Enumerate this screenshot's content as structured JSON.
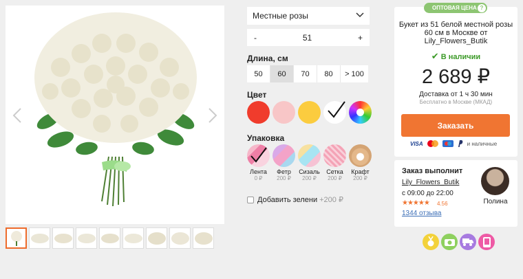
{
  "gallery": {
    "thumb_count": 9,
    "active_thumb": 0
  },
  "options": {
    "variety": "Местные розы",
    "quantity": {
      "minus": "-",
      "value": "51",
      "plus": "+"
    },
    "length": {
      "label": "Длина, см",
      "items": [
        "50",
        "60",
        "70",
        "80",
        "> 100"
      ],
      "selected": "60"
    },
    "color": {
      "label": "Цвет",
      "items": [
        {
          "name": "red",
          "hex": "#f03c2c"
        },
        {
          "name": "pink",
          "hex": "#f8c6c7"
        },
        {
          "name": "yellow",
          "hex": "#fbcc3f"
        },
        {
          "name": "white",
          "hex": "#ffffff"
        },
        {
          "name": "multicolor",
          "hex": "rainbow"
        }
      ],
      "selected": "white"
    },
    "packaging": {
      "label": "Упаковка",
      "items": [
        {
          "name": "Лента",
          "price": "0 ₽"
        },
        {
          "name": "Фетр",
          "price": "200 ₽"
        },
        {
          "name": "Сизаль",
          "price": "200 ₽"
        },
        {
          "name": "Сетка",
          "price": "200 ₽"
        },
        {
          "name": "Крафт",
          "price": "200 ₽"
        }
      ],
      "selected": "Лента"
    },
    "greens": {
      "label": "Добавить зелени",
      "price": "+200 ₽"
    }
  },
  "product": {
    "badge": "ОПТОВАЯ ЦЕНА",
    "badge_help": "?",
    "title": "Букет из 51 белой местной розы 60 см в Москве от Lily_Flowers_Butik",
    "stock": "В наличии",
    "price": "2 689 ₽",
    "delivery": "Доставка от 1 ч 30 мин",
    "delivery_note": "Бесплатно в Москве (МКАД)",
    "order_button": "Заказать",
    "payment": {
      "visa": "VISA",
      "cash": "и наличные"
    }
  },
  "seller": {
    "heading": "Заказ выполнит",
    "name": "Lily_Flowers_Butik",
    "hours": "с 09:00 до 22:00",
    "stars": 5,
    "rating": "4.56",
    "reviews": "1344 отзыва",
    "avatar_name": "Полина"
  },
  "achievements": [
    {
      "icon": "medal-icon",
      "color": "#f3d23a"
    },
    {
      "icon": "camera-icon",
      "color": "#8ed05f"
    },
    {
      "icon": "delivery-icon",
      "color": "#a77be0"
    },
    {
      "icon": "phone-icon",
      "color": "#ee5aa5"
    }
  ]
}
